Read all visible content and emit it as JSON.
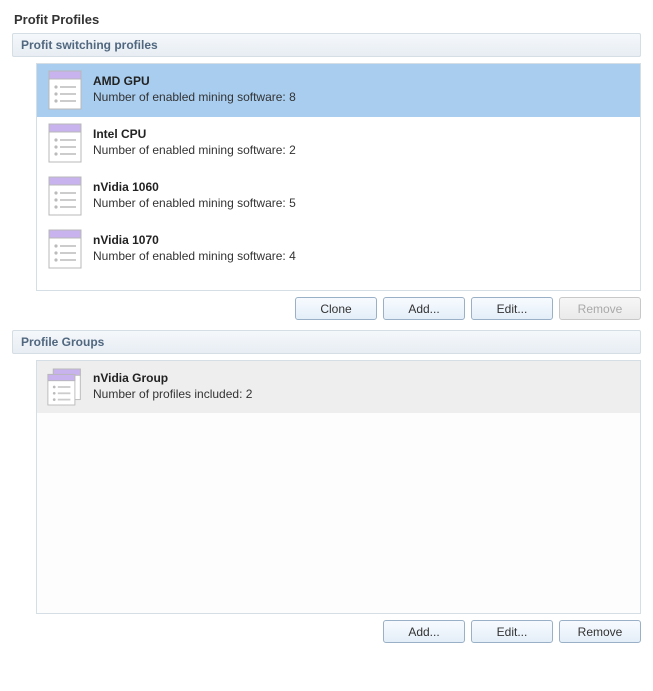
{
  "page_title": "Profit Profiles",
  "profiles_section": {
    "header": "Profit switching profiles",
    "items": [
      {
        "name": "AMD GPU",
        "subtitle": "Number of enabled mining software: 8",
        "selected": true
      },
      {
        "name": "Intel CPU",
        "subtitle": "Number of enabled mining software: 2",
        "selected": false
      },
      {
        "name": "nVidia 1060",
        "subtitle": "Number of enabled mining software: 5",
        "selected": false
      },
      {
        "name": "nVidia 1070",
        "subtitle": "Number of enabled mining software: 4",
        "selected": false
      }
    ],
    "buttons": {
      "clone": "Clone",
      "add": "Add...",
      "edit": "Edit...",
      "remove": "Remove",
      "remove_enabled": false
    }
  },
  "groups_section": {
    "header": "Profile Groups",
    "items": [
      {
        "name": "nVidia Group",
        "subtitle": "Number of profiles included: 2"
      }
    ],
    "buttons": {
      "add": "Add...",
      "edit": "Edit...",
      "remove": "Remove"
    }
  }
}
